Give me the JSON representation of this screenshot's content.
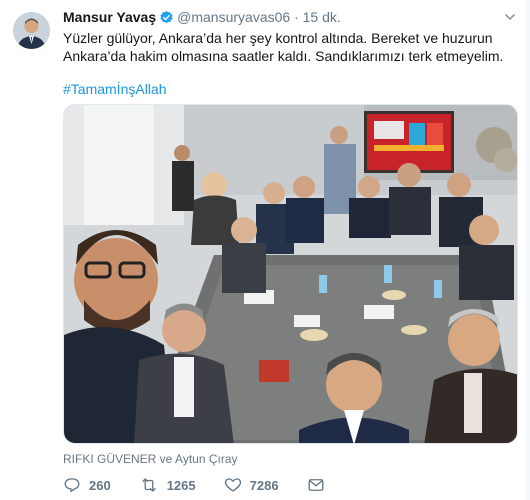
{
  "tweet": {
    "author_name": "Mansur Yavaş",
    "handle": "@mansuryavas06",
    "separator": "·",
    "time": "15 dk.",
    "text": "Yüzler gülüyor, Ankara’da her şey kontrol altında. Bereket ve huzurun Ankara’da hakim olmasına saatler kaldı. Sandıklarımızı terk etmeyelim.",
    "hashtag": "#TamamİnşAllah",
    "tagged_people": "RIFKI GÜVENER ve Aytun Çıray"
  },
  "actions": {
    "replies": "260",
    "retweets": "1265",
    "likes": "7286"
  },
  "icons": {
    "verified": "verified-badge-icon",
    "reply": "reply-icon",
    "retweet": "retweet-icon",
    "like": "heart-icon",
    "dm": "direct-message-icon",
    "more": "chevron-down-icon"
  },
  "colors": {
    "link": "#1b95e0",
    "secondary_text": "#657786",
    "verified": "#1da1f2"
  }
}
